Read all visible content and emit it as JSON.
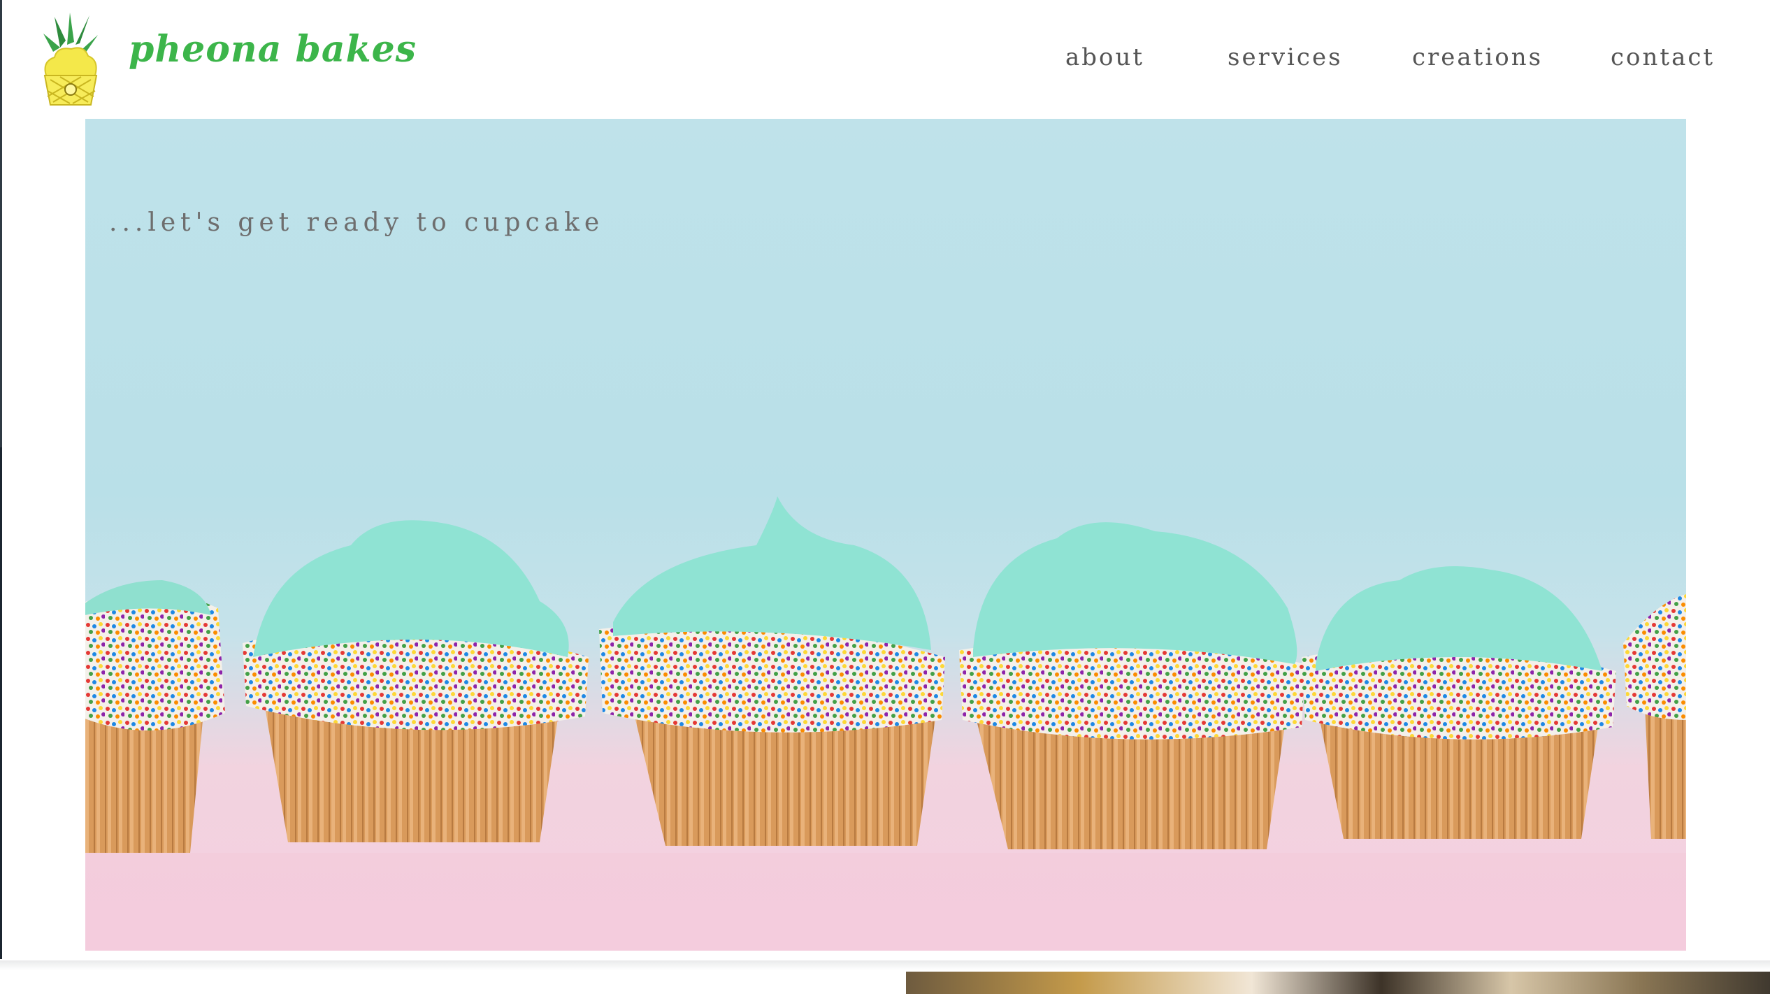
{
  "brand": {
    "name": "pheona bakes",
    "logo_icon": "pineapple-cupcake-logo",
    "color": "#3cb54a"
  },
  "nav": {
    "items": [
      {
        "label": "about"
      },
      {
        "label": "services"
      },
      {
        "label": "creations"
      },
      {
        "label": "contact"
      }
    ]
  },
  "hero": {
    "tagline": "...let's get ready to cupcake",
    "image": "cupcakes-with-mint-frosting-and-sprinkles"
  }
}
